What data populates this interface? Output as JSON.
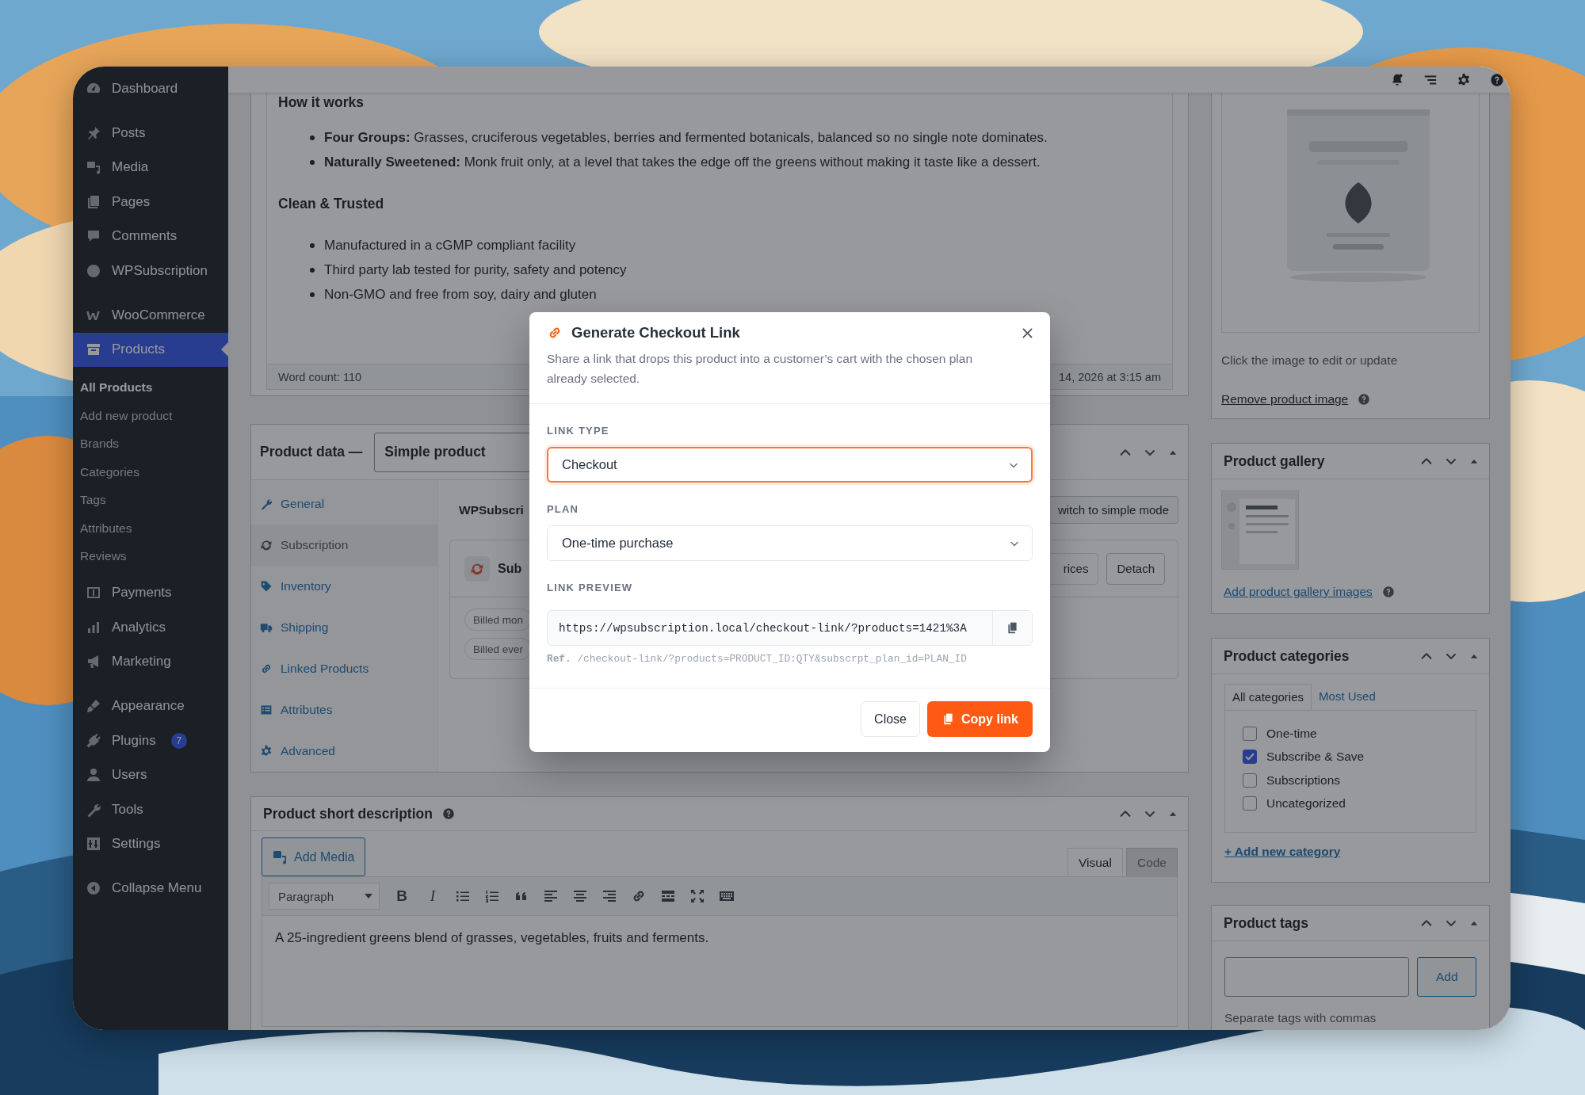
{
  "sidebar": {
    "groups": [
      [
        {
          "label": "Dashboard",
          "selected": false
        }
      ],
      [
        {
          "label": "Posts",
          "selected": false
        },
        {
          "label": "Media",
          "selected": false
        },
        {
          "label": "Pages",
          "selected": false
        },
        {
          "label": "Comments",
          "selected": false
        },
        {
          "label": "WPSubscription",
          "selected": false
        }
      ],
      [
        {
          "label": "WooCommerce",
          "selected": false
        },
        {
          "label": "Products",
          "selected": true,
          "children": [
            {
              "label": "All Products",
              "selected": true
            },
            {
              "label": "Add new product",
              "selected": false
            },
            {
              "label": "Brands",
              "selected": false
            },
            {
              "label": "Categories",
              "selected": false
            },
            {
              "label": "Tags",
              "selected": false
            },
            {
              "label": "Attributes",
              "selected": false
            },
            {
              "label": "Reviews",
              "selected": false
            }
          ]
        },
        {
          "label": "Payments",
          "selected": false
        },
        {
          "label": "Analytics",
          "selected": false
        },
        {
          "label": "Marketing",
          "selected": false
        }
      ],
      [
        {
          "label": "Appearance",
          "selected": false
        },
        {
          "label": "Plugins",
          "selected": false,
          "badge": "7"
        },
        {
          "label": "Users",
          "selected": false
        },
        {
          "label": "Tools",
          "selected": false
        },
        {
          "label": "Settings",
          "selected": false
        }
      ],
      [
        {
          "label": "Collapse Menu",
          "selected": false
        }
      ]
    ]
  },
  "editor": {
    "blocks": [
      {
        "kind": "heading",
        "text": "How it works"
      },
      {
        "kind": "list",
        "items": [
          "**Four Groups:** Grasses, cruciferous vegetables, berries and fermented botanicals, balanced so no single note dominates.",
          "**Naturally Sweetened:** Monk fruit only, at a level that takes the edge off the greens without making it taste like a dessert."
        ]
      },
      {
        "kind": "heading",
        "text": "Clean & Trusted"
      },
      {
        "kind": "list",
        "items": [
          "Manufactured in a cGMP compliant facility",
          "Third party lab tested for purity, safety and potency",
          "Non-GMO and free from soy, dairy and gluten"
        ]
      }
    ],
    "word_count": "Word count: 110",
    "last_edited": "14, 2026 at 3:15 am"
  },
  "product_data": {
    "title": "Product data —",
    "type": "Simple product",
    "tabs": [
      {
        "label": "General",
        "selected": false
      },
      {
        "label": "Subscription",
        "selected": true
      },
      {
        "label": "Inventory",
        "selected": false
      },
      {
        "label": "Shipping",
        "selected": false
      },
      {
        "label": "Linked Products",
        "selected": false
      },
      {
        "label": "Attributes",
        "selected": false
      },
      {
        "label": "Advanced",
        "selected": false
      }
    ],
    "panel": {
      "heading": "WPSubscri",
      "mode_button": "witch to simple mode",
      "plan_title": "Sub",
      "buttons": [
        "rices",
        "Detach"
      ],
      "chips": [
        "Billed mon",
        "Billed ever"
      ]
    }
  },
  "short_description": {
    "title": "Product short description",
    "add_media": "Add Media",
    "tabs": [
      {
        "label": "Visual",
        "selected": true
      },
      {
        "label": "Code",
        "selected": false
      }
    ],
    "format": "Paragraph",
    "toolbar": [
      {
        "kind": "bold",
        "label": "B"
      },
      {
        "kind": "italic",
        "label": "I"
      },
      {
        "kind": "bullet-list"
      },
      {
        "kind": "number-list"
      },
      {
        "kind": "quote"
      },
      {
        "kind": "align-left"
      },
      {
        "kind": "align-center"
      },
      {
        "kind": "align-right"
      },
      {
        "kind": "link"
      },
      {
        "kind": "more"
      },
      {
        "kind": "fullscreen"
      },
      {
        "kind": "keyboard"
      }
    ],
    "text": "A 25-ingredient greens blend of grasses, vegetables, fruits and ferments."
  },
  "featured_image": {
    "kind": "picture",
    "hint": "Click the image to edit or update",
    "remove_link": "Remove product image"
  },
  "gallery": {
    "title": "Product gallery",
    "link": "Add product gallery images"
  },
  "categories": {
    "title": "Product categories",
    "tabs": [
      {
        "label": "All categories",
        "selected": true
      },
      {
        "label": "Most Used",
        "selected": false
      }
    ],
    "items": [
      {
        "label": "One-time",
        "checked": false
      },
      {
        "label": "Subscribe & Save",
        "checked": true
      },
      {
        "label": "Subscriptions",
        "checked": false
      },
      {
        "label": "Uncategorized",
        "checked": false
      }
    ],
    "add_link": "+ Add new category"
  },
  "tags": {
    "title": "Product tags",
    "button": "Add",
    "hint": "Separate tags with commas"
  },
  "modal": {
    "title": "Generate Checkout Link",
    "description": "Share a link that drops this product into a customer’s cart with the chosen plan already selected.",
    "fields": [
      {
        "label": "LINK TYPE",
        "value": "Checkout",
        "focused": true
      },
      {
        "label": "PLAN",
        "value": "One-time purchase",
        "focused": false
      }
    ],
    "preview_label": "LINK PREVIEW",
    "preview_url": "https://wpsubscription.local/checkout-link/?products=1421%3A",
    "ref_label": "Ref.",
    "ref_text": "/checkout-link/?products=PRODUCT_ID:QTY&subscrpt_plan_id=PLAN_ID",
    "buttons": [
      {
        "label": "Close",
        "kind": "secondary"
      },
      {
        "label": "Copy link",
        "kind": "primary"
      }
    ]
  }
}
